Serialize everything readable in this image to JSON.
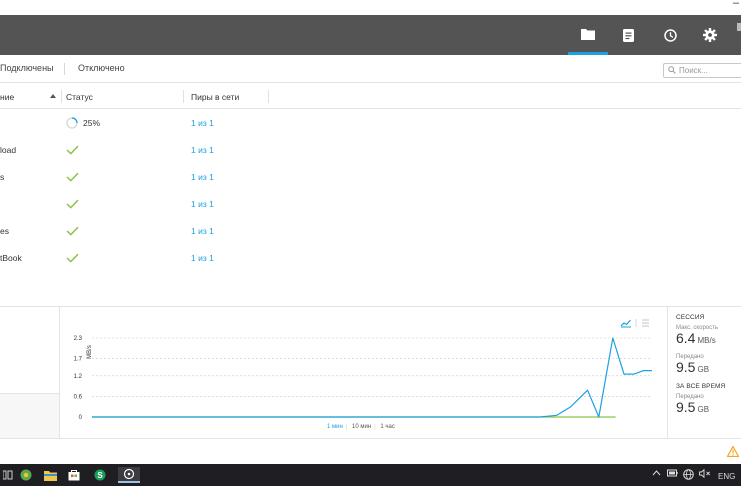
{
  "window": {
    "minimize_glyph": "–"
  },
  "header": {
    "buttons": [
      {
        "icon": "folder-icon",
        "active": true
      },
      {
        "icon": "document-list-icon",
        "active": false
      },
      {
        "icon": "clock-icon",
        "active": false
      },
      {
        "icon": "gear-icon",
        "active": false
      }
    ]
  },
  "filters": {
    "tab_connected": "Подключены",
    "tab_disabled": "Отключено"
  },
  "search": {
    "placeholder": "Поиск..."
  },
  "table": {
    "columns": {
      "name": "ние",
      "status": "Статус",
      "peers": "Пиры в сети"
    },
    "rows": [
      {
        "name": "",
        "status": "syncing",
        "progress": "25%",
        "peers": "1 из 1"
      },
      {
        "name": "load",
        "status": "ok",
        "peers": "1 из 1"
      },
      {
        "name": "s",
        "status": "ok",
        "peers": "1 из 1"
      },
      {
        "name": "",
        "status": "ok",
        "peers": "1 из 1"
      },
      {
        "name": "es",
        "status": "ok",
        "peers": "1 из 1"
      },
      {
        "name": "tBook",
        "status": "ok",
        "peers": "1 из 1"
      }
    ]
  },
  "chart_data": {
    "type": "line",
    "title": "",
    "xlabel": "",
    "ylabel": "MB/s",
    "yticks": [
      "2.3",
      "1.7",
      "1.2",
      "0.6",
      "0"
    ],
    "ylim": [
      0,
      2.3
    ],
    "grid": true,
    "series": [
      {
        "name": "Передано",
        "color": "#1ba1e2",
        "points": [
          [
            0.0,
            0
          ],
          [
            0.8,
            0
          ],
          [
            0.83,
            0.05
          ],
          [
            0.855,
            0.3
          ],
          [
            0.885,
            0.78
          ],
          [
            0.905,
            0.0
          ],
          [
            0.93,
            2.3
          ],
          [
            0.95,
            1.25
          ],
          [
            0.968,
            1.25
          ],
          [
            0.985,
            1.35
          ],
          [
            1.0,
            1.35
          ]
        ]
      },
      {
        "name": "",
        "color": "#8bc34a",
        "points": [
          [
            0.0,
            0
          ],
          [
            0.935,
            0
          ]
        ]
      }
    ],
    "time_options": [
      "1 мин",
      "10 мин",
      "1 час"
    ],
    "time_selected": "1 мин"
  },
  "stats": {
    "session_label": "СЕССИЯ",
    "max_speed_label": "Макс. скорость",
    "max_speed_value": "6.4",
    "max_speed_unit": "MB/s",
    "transferred_label": "Передано",
    "transferred_value": "9.5",
    "transferred_unit": "GB",
    "alltime_label": "ЗА ВСЕ ВРЕМЯ",
    "alltime_transferred_label": "Передано",
    "alltime_transferred_value": "9.5",
    "alltime_transferred_unit": "GB"
  },
  "taskbar": {
    "lang": "ENG",
    "colors": {
      "accent": "#1ba1e2",
      "ok": "#8bc34a",
      "warn": "#f5a623"
    }
  }
}
